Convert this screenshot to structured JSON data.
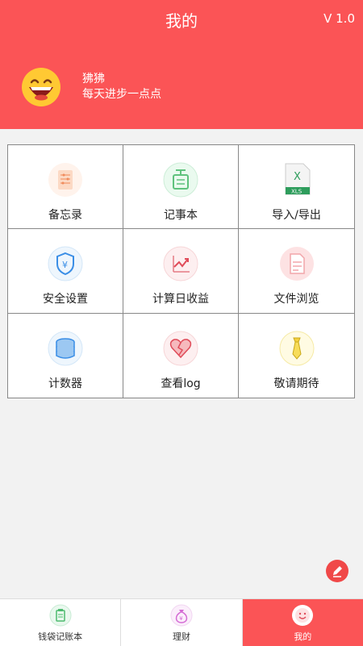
{
  "header": {
    "title": "我的",
    "version": "V 1.0",
    "user_name": "狒狒",
    "user_motto": "每天进步一点点",
    "color": "#fb5456"
  },
  "grid": [
    {
      "label": "备忘录",
      "icon": "memo-icon"
    },
    {
      "label": "记事本",
      "icon": "notebook-icon"
    },
    {
      "label": "导入/导出",
      "icon": "excel-xls-icon"
    },
    {
      "label": "安全设置",
      "icon": "shield-yen-icon"
    },
    {
      "label": "计算日收益",
      "icon": "chart-icon"
    },
    {
      "label": "文件浏览",
      "icon": "document-icon"
    },
    {
      "label": "计数器",
      "icon": "coin-stack-icon"
    },
    {
      "label": "查看log",
      "icon": "broken-heart-icon"
    },
    {
      "label": "敬请期待",
      "icon": "tie-icon"
    }
  ],
  "tabs": [
    {
      "label": "钱袋记账本",
      "icon": "clipboard-icon",
      "active": false
    },
    {
      "label": "理财",
      "icon": "money-bag-icon",
      "active": false
    },
    {
      "label": "我的",
      "icon": "avatar-icon",
      "active": true
    }
  ],
  "fab_icon": "edit-pencil-icon"
}
